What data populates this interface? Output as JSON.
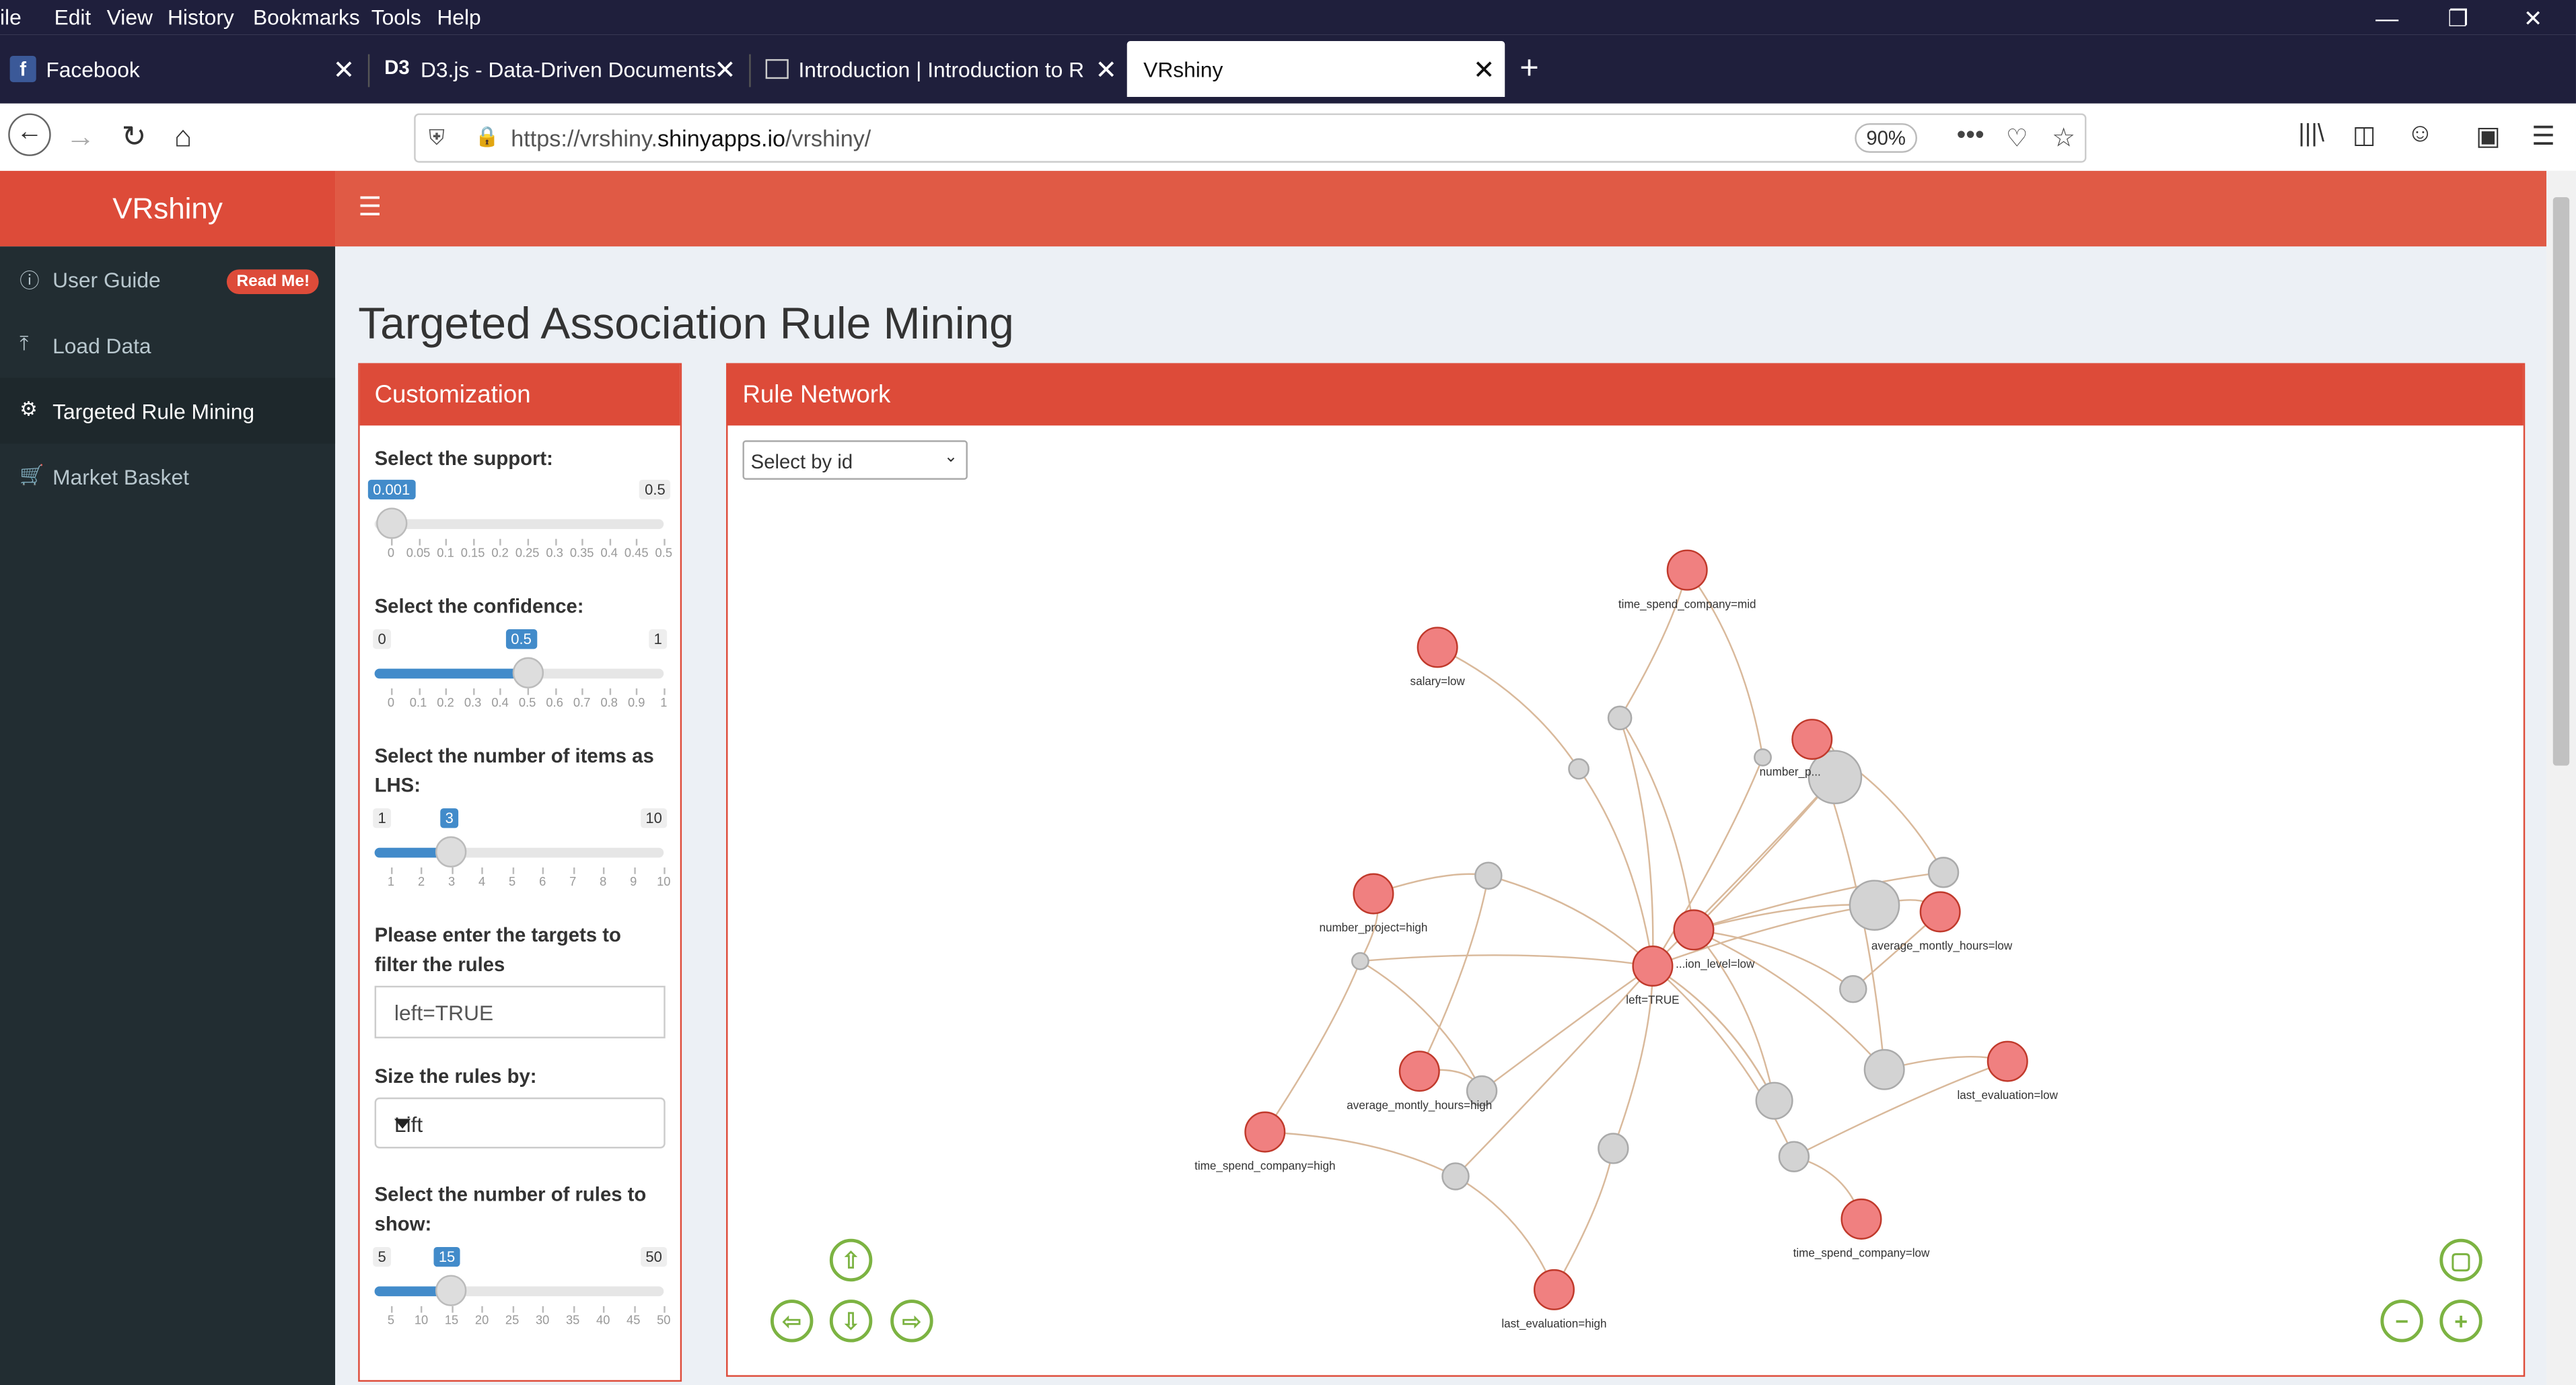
{
  "menu": [
    "ile",
    "Edit",
    "View",
    "History",
    "Bookmarks",
    "Tools",
    "Help"
  ],
  "tabs": [
    {
      "label": "Facebook",
      "active": false
    },
    {
      "label": "D3.js - Data-Driven Documents",
      "active": false
    },
    {
      "label": "Introduction | Introduction to R",
      "active": false
    },
    {
      "label": "VRshiny",
      "active": true
    }
  ],
  "address": {
    "prefix": "https://vrshiny.",
    "domain": "shinyapps.io",
    "path": "/vrshiny/",
    "zoom": "90%"
  },
  "app": {
    "title": "VRshiny"
  },
  "sidebar": {
    "items": [
      {
        "label": "User Guide",
        "badge": "Read Me!"
      },
      {
        "label": "Load Data"
      },
      {
        "label": "Targeted Rule Mining"
      },
      {
        "label": "Market Basket"
      }
    ]
  },
  "page_title": "Targeted Association Rule Mining",
  "customization": {
    "title": "Customization",
    "support": {
      "label": "Select the support:",
      "min": "0.001",
      "max": "0.5",
      "value": "0.001",
      "fraction": 0.0,
      "ticks": [
        "0",
        "0.05",
        "0.1",
        "0.15",
        "0.2",
        "0.25",
        "0.3",
        "0.35",
        "0.4",
        "0.45",
        "0.5"
      ]
    },
    "confidence": {
      "label": "Select the confidence:",
      "min": "0",
      "max": "1",
      "value": "0.5",
      "fraction": 0.5,
      "ticks": [
        "0",
        "0.1",
        "0.2",
        "0.3",
        "0.4",
        "0.5",
        "0.6",
        "0.7",
        "0.8",
        "0.9",
        "1"
      ]
    },
    "lhs": {
      "label": "Select the number of items as LHS:",
      "min": "1",
      "max": "10",
      "value": "3",
      "fraction": 0.2222,
      "ticks": [
        "1",
        "2",
        "3",
        "4",
        "5",
        "6",
        "7",
        "8",
        "9",
        "10"
      ]
    },
    "targets": {
      "label": "Please enter the targets to filter the rules",
      "value": "left=TRUE"
    },
    "size_by": {
      "label": "Size the rules by:",
      "value": "Lift"
    },
    "nrules": {
      "label": "Select the number of rules to show:",
      "min": "5",
      "max": "50",
      "value": "15",
      "fraction": 0.2222,
      "ticks": [
        "5",
        "10",
        "15",
        "20",
        "25",
        "30",
        "35",
        "40",
        "45",
        "50"
      ]
    }
  },
  "network": {
    "title": "Rule Network",
    "select_placeholder": "Select by id",
    "colors": {
      "item": "#f08080",
      "rule": "#d3d3d3",
      "edge": "#d9b99b",
      "nav": "#7cb342"
    },
    "labels": [
      "time_spend_company=mid",
      "salary=low",
      "number_p...",
      "average_montly_hours=low",
      "number_project=high",
      "left=TRUE",
      "...ion_level=low",
      "average_montly_hours=high",
      "last_evaluation=low",
      "time_spend_company=high",
      "time_spend_company=low",
      "last_evaluation=high"
    ]
  }
}
